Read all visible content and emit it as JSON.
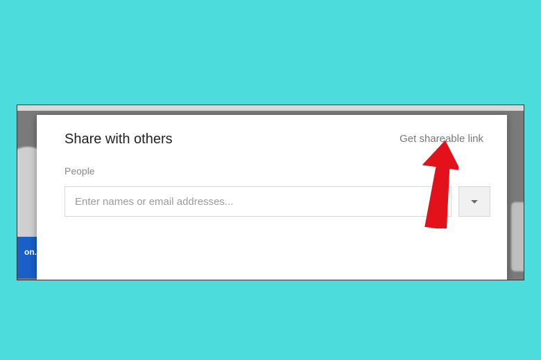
{
  "dialog": {
    "title": "Share with others",
    "shareable_link_label": "Get shareable link",
    "people_label": "People",
    "people_placeholder": "Enter names or email addresses..."
  },
  "backdrop": {
    "left_badge_text": "on."
  }
}
